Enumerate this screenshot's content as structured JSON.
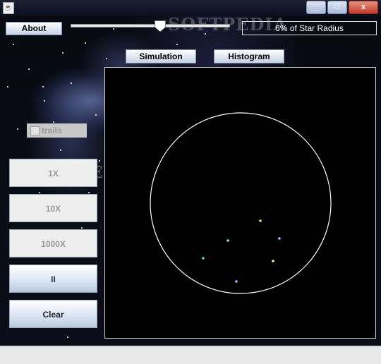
{
  "window": {
    "close_glyph": "x",
    "minimize_glyph": "_",
    "maximize_glyph": "□"
  },
  "watermark": "SOFTPEDIA",
  "toolbar": {
    "about_label": "About",
    "slider_value_percent": 6,
    "radius_readout": "6% of Star Radius"
  },
  "tabs": [
    {
      "label": "Simulation"
    },
    {
      "label": "Histogram"
    }
  ],
  "controls": {
    "trails_label": "trails",
    "trails_checked": false,
    "speed_buttons": [
      {
        "label": "1X",
        "enabled": false
      },
      {
        "label": "10X",
        "enabled": false
      },
      {
        "label": "1000X",
        "enabled": false
      }
    ],
    "pause_label": "II",
    "clear_label": "Clear"
  },
  "simulation": {
    "circle_color": "#ffffff",
    "particles": [
      {
        "color": "#e0e090"
      },
      {
        "color": "#90e0e0"
      },
      {
        "color": "#a0c8ff"
      },
      {
        "color": "#70d0e0"
      },
      {
        "color": "#f0f0b0"
      },
      {
        "color": "#e0a0ff"
      }
    ]
  },
  "icons": [
    "java-cup-icon",
    "minimize-icon",
    "maximize-icon",
    "close-icon"
  ]
}
